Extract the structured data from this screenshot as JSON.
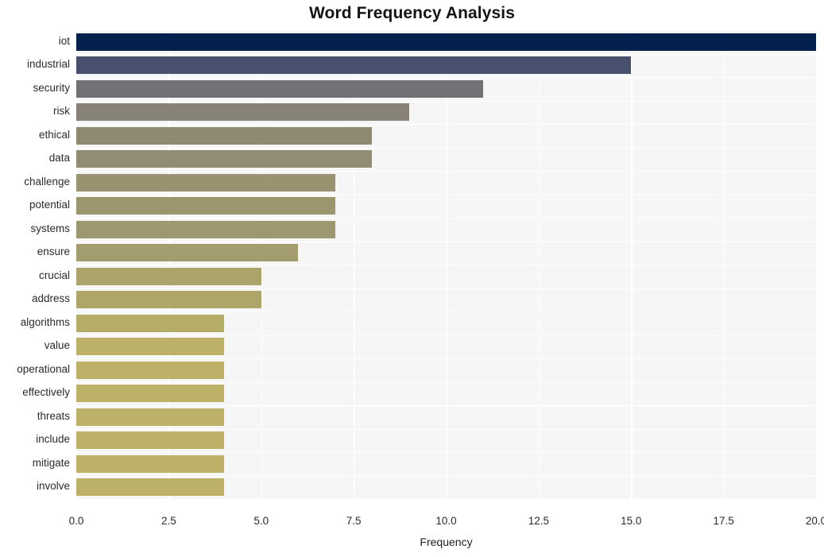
{
  "chart_data": {
    "type": "bar",
    "orientation": "horizontal",
    "title": "Word Frequency Analysis",
    "xlabel": "Frequency",
    "ylabel": "",
    "xlim": [
      0.0,
      20.0
    ],
    "xticks": [
      "0.0",
      "2.5",
      "5.0",
      "7.5",
      "10.0",
      "12.5",
      "15.0",
      "17.5",
      "20.0"
    ],
    "xtick_values": [
      0.0,
      2.5,
      5.0,
      7.5,
      10.0,
      12.5,
      15.0,
      17.5,
      20.0
    ],
    "grid": true,
    "grid_axis": "both",
    "legend": "none",
    "categories": [
      "iot",
      "industrial",
      "security",
      "risk",
      "ethical",
      "data",
      "challenge",
      "potential",
      "systems",
      "ensure",
      "crucial",
      "address",
      "algorithms",
      "value",
      "operational",
      "effectively",
      "threats",
      "include",
      "mitigate",
      "involve"
    ],
    "values": [
      20,
      15,
      11,
      9,
      8,
      8,
      7,
      7,
      7,
      6,
      5,
      5,
      4,
      4,
      4,
      4,
      4,
      4,
      4,
      4
    ],
    "bar_colors": [
      "#04214e",
      "#47506e",
      "#717176",
      "#868277",
      "#8e8a72",
      "#918d74",
      "#999372",
      "#9c966f",
      "#9e9870",
      "#a39c6e",
      "#aba46a",
      "#aea668",
      "#b5ac66",
      "#bcb167",
      "#bcb167",
      "#bcb167",
      "#bcb167",
      "#bcb167",
      "#bcb167",
      "#bcb167"
    ],
    "plot_background": "#f6f6f7",
    "gridline_color": "#ffffff",
    "figure_background": "#ffffff",
    "title_color": "#141414",
    "tick_color": "#2b2b2b"
  }
}
